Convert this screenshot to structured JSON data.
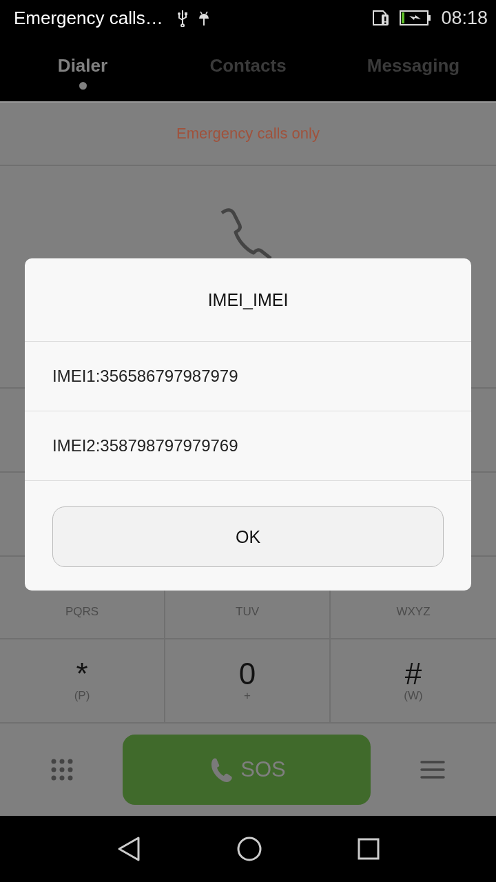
{
  "status_bar": {
    "notification": "Emergency calls…",
    "time": "08:18"
  },
  "tabs": [
    {
      "label": "Dialer",
      "selected": true
    },
    {
      "label": "Contacts",
      "selected": false
    },
    {
      "label": "Messaging",
      "selected": false
    }
  ],
  "network_status": "Emergency calls only",
  "keypad": [
    {
      "letters": "PQRS"
    },
    {
      "letters": "TUV"
    },
    {
      "letters": "WXYZ"
    },
    {
      "digit": "*",
      "letters": "(P)"
    },
    {
      "digit": "0",
      "letters": "+"
    },
    {
      "digit": "#",
      "letters": "(W)"
    }
  ],
  "call_button": "SOS",
  "dialog": {
    "title": "IMEI_IMEI",
    "items": [
      "IMEI1:356586797987979",
      "IMEI2:358798797979769"
    ],
    "button": "OK"
  }
}
